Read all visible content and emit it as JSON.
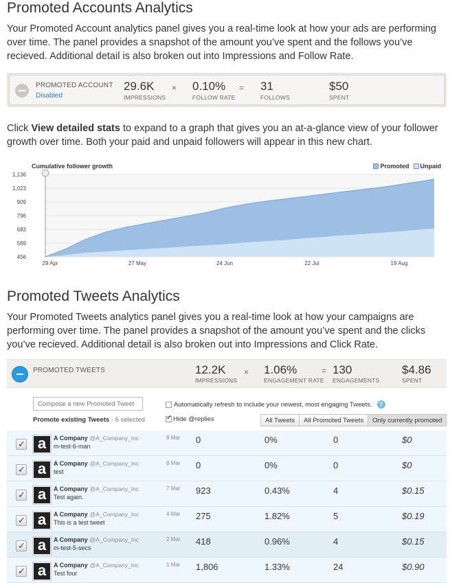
{
  "section1": {
    "title": "Promoted Accounts Analytics",
    "body": "Your Promoted Account analytics panel gives you a real-time look at how your ads are performing over time. The panel provides a snapshot of the amount you’ve spent and the follows you’ve recieved. Additional detail is also broken out into Impressions and Follow Rate."
  },
  "account_box": {
    "label": "PROMOTED ACCOUNT",
    "status": "Disabled",
    "impressions_value": "29.6K",
    "impressions_label": "IMPRESSIONS",
    "times": "×",
    "rate_value": "0.10%",
    "rate_label": "FOLLOW RATE",
    "equals": "=",
    "follows_value": "31",
    "follows_label": "FOLLOWS",
    "spent_value": "$50",
    "spent_label": "SPENT"
  },
  "section2": {
    "body_prefix": "Click ",
    "body_bold": "View detailed stats",
    "body_suffix": " to expand to a graph that gives you an at-a-glance view of your follower growth over time. Both your paid and unpaid followers will appear in this new chart."
  },
  "chart_data": {
    "type": "area",
    "title": "Cumulative follower growth",
    "legend": [
      "Promoted",
      "Unpaid"
    ],
    "legend_position": "top-right",
    "x_ticks": [
      "29 Apr",
      "27 May",
      "24 Jun",
      "22 Jul",
      "19 Aug"
    ],
    "y_ticks": [
      456,
      569,
      683,
      796,
      909,
      "1,023",
      "1,136"
    ],
    "ylim": [
      456,
      1136
    ],
    "x": [
      0,
      7,
      14,
      21,
      28,
      35,
      42,
      49,
      56,
      63,
      70,
      77,
      84,
      91,
      98,
      105,
      112,
      119,
      126,
      133,
      136
    ],
    "series": [
      {
        "name": "Promoted",
        "color": "#9dbfe4",
        "values": [
          456,
          520,
          600,
          660,
          700,
          730,
          760,
          790,
          820,
          860,
          890,
          915,
          935,
          955,
          975,
          995,
          1015,
          1035,
          1060,
          1085,
          1098
        ]
      },
      {
        "name": "Unpaid",
        "color": "#cfe3f7",
        "values": [
          456,
          470,
          490,
          500,
          510,
          520,
          530,
          540,
          550,
          560,
          575,
          585,
          595,
          610,
          622,
          635,
          645,
          658,
          670,
          685,
          690
        ]
      }
    ],
    "colors": {
      "promoted": "#9dbfe4",
      "unpaid": "#cfe3f7",
      "stroke": "#7aa7d8",
      "annotation_marker": "#999999"
    }
  },
  "section3": {
    "title": "Promoted Tweets Analytics",
    "body": "Your Promoted Tweets analytics panel gives you a real-time look at how your campaigns are performing over time. The panel provides a snapshot of the amount you’ve spent and the clicks you’ve recieved. Additional detail is also broken out into Impressions and Click Rate."
  },
  "tweets_panel": {
    "label": "PROMOTED TWEETS",
    "impressions_value": "12.2K",
    "impressions_label": "IMPRESSIONS",
    "times": "×",
    "rate_value": "1.06%",
    "rate_label": "ENGAGEMENT RATE",
    "equals": "=",
    "engagements_value": "130",
    "engagements_label": "ENGAGEMENTS",
    "spent_value": "$4.86",
    "spent_label": "SPENT",
    "compose_placeholder": "Compose a new Promoted Tweet",
    "auto_refresh": "Automatically refresh to include your newest, most engaging Tweets.",
    "help": "?",
    "promote_existing": "Promote existing Tweets",
    "selected_count": " · 6 selected",
    "hide_replies": "Hide @replies",
    "filters": [
      "All Tweets",
      "All Promoted Tweets",
      "Only currently promoted"
    ]
  },
  "tweets": [
    {
      "name": "A Company",
      "handle": "@A_Company_Inc",
      "text": "m-test-6-man",
      "date": "8 Mar",
      "impressions": "0",
      "rate": "0%",
      "engagements": "0",
      "spent": "$0"
    },
    {
      "name": "A Company",
      "handle": "@A_Company_Inc",
      "text": "test",
      "date": "8 Mar",
      "impressions": "0",
      "rate": "0%",
      "engagements": "0",
      "spent": "$0"
    },
    {
      "name": "A Company",
      "handle": "@A_Company_Inc",
      "text": "Test again.",
      "date": "7 Mar",
      "impressions": "923",
      "rate": "0.43%",
      "engagements": "4",
      "spent": "$0.15"
    },
    {
      "name": "A Company",
      "handle": "@A_Company_Inc",
      "text": "This is a test tweet",
      "date": "4 Mar",
      "impressions": "275",
      "rate": "1.82%",
      "engagements": "5",
      "spent": "$0.19"
    },
    {
      "name": "A Company",
      "handle": "@A_Company_Inc",
      "text": "m-test-5-secs",
      "date": "2 Mar",
      "impressions": "418",
      "rate": "0.96%",
      "engagements": "4",
      "spent": "$0.15"
    },
    {
      "name": "A Company",
      "handle": "@A_Company_Inc",
      "text": "Test four",
      "date": "1 Mar",
      "impressions": "1,806",
      "rate": "1.33%",
      "engagements": "24",
      "spent": "$0.90"
    }
  ]
}
